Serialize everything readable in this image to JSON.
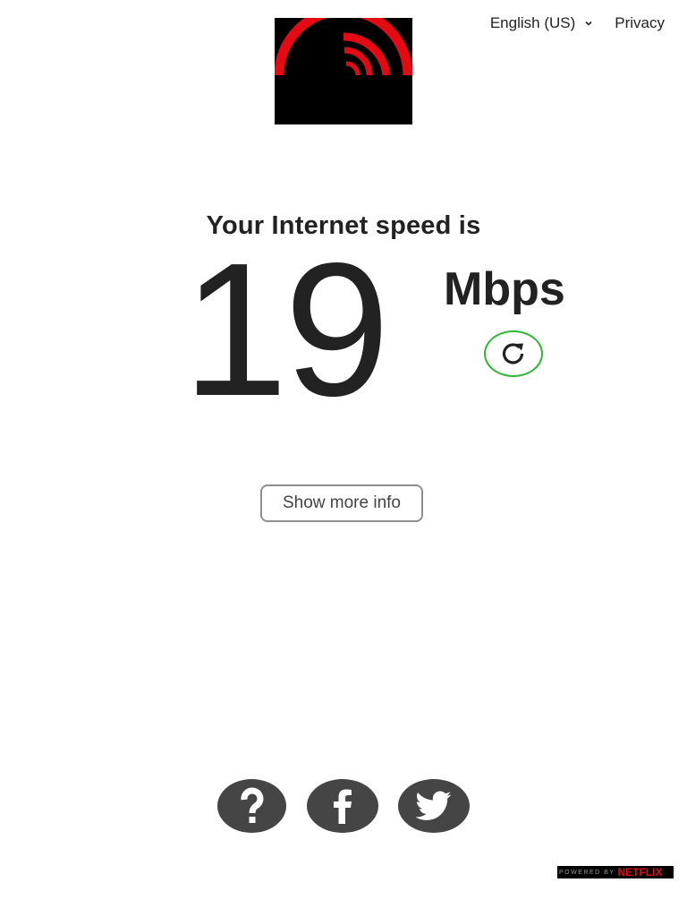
{
  "header": {
    "language_label": "English (US)",
    "privacy_label": "Privacy"
  },
  "result": {
    "label": "Your Internet speed is",
    "value": "19",
    "units": "Mbps"
  },
  "actions": {
    "more_info_label": "Show more info"
  },
  "footer": {
    "powered_by_label": "POWERED BY",
    "brand_label": "NETFLIX"
  },
  "colors": {
    "brand_red": "#e50914",
    "refresh_green": "#2fb733",
    "social_gray": "#454545",
    "text_dark": "#222222"
  },
  "icons": {
    "logo": "speed-arcs-logo-icon",
    "language": "chevron-down-icon",
    "refresh": "refresh-icon",
    "help": "question-mark-icon",
    "facebook": "facebook-icon",
    "twitter": "twitter-bird-icon"
  }
}
